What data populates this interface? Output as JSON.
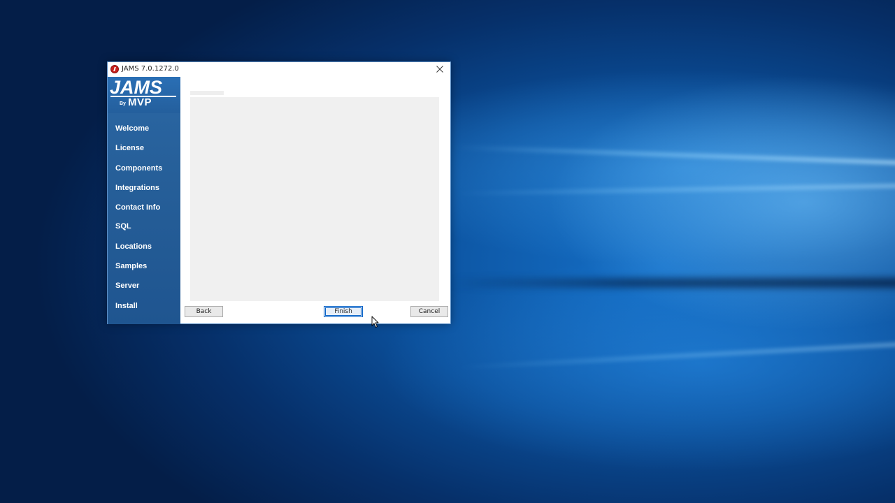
{
  "window": {
    "title": "JAMS 7.0.1272.0"
  },
  "logo": {
    "brand": "JAMS",
    "by": "By",
    "company": "MVP"
  },
  "sidebar": {
    "items": [
      {
        "label": "Welcome"
      },
      {
        "label": "License"
      },
      {
        "label": "Components"
      },
      {
        "label": "Integrations"
      },
      {
        "label": "Contact Info"
      },
      {
        "label": "SQL"
      },
      {
        "label": "Locations"
      },
      {
        "label": "Samples"
      },
      {
        "label": "Server"
      },
      {
        "label": "Install"
      }
    ]
  },
  "buttons": {
    "back": "Back",
    "finish": "Finish",
    "cancel": "Cancel"
  },
  "icons": {
    "app": "jams-app-icon",
    "close": "close-icon",
    "cursor": "mouse-pointer-icon"
  },
  "colors": {
    "sidebar": "#265f99",
    "accent": "#0a64c8",
    "desktop": "#0b4f9a"
  }
}
